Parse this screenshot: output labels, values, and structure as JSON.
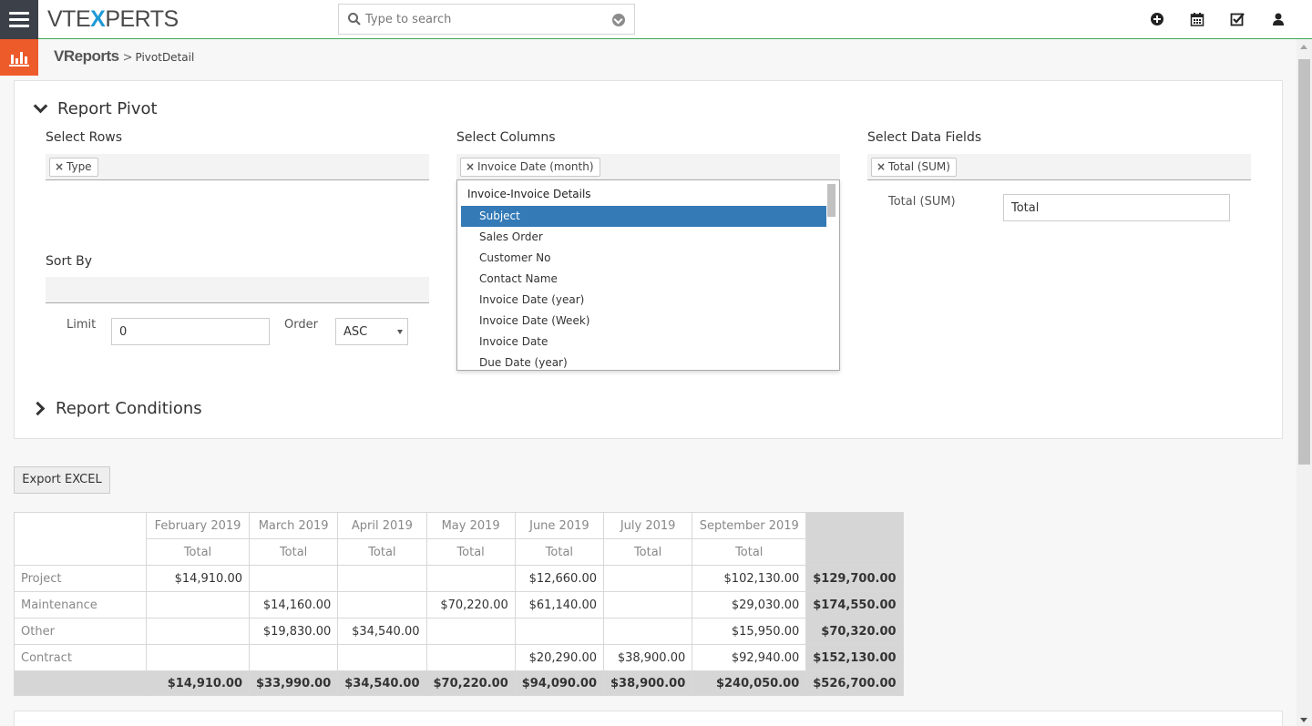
{
  "app": {
    "logo_part1": "VTE",
    "logo_x": "X",
    "logo_part2": "PERTS",
    "search_placeholder": "Type to search"
  },
  "icons": {
    "menu": "hamburger-menu-icon",
    "search": "search-icon",
    "search_dropdown": "chevron-down-icon",
    "add": "plus-circle-icon",
    "calendar": "calendar-icon",
    "tasks": "checkbox-icon",
    "user": "user-icon",
    "module": "bar-chart-icon"
  },
  "colors": {
    "accent_green": "#3aaa57",
    "module_orange": "#ee5b2b",
    "selected_blue": "#337ab7",
    "nav_dark": "#3c4049"
  },
  "breadcrumb": {
    "module": "VReports",
    "separator": ">",
    "page": "PivotDetail"
  },
  "report_pivot": {
    "title": "Report Pivot",
    "select_rows": {
      "label": "Select Rows",
      "tags": [
        "Type"
      ]
    },
    "select_columns": {
      "label": "Select Columns",
      "tags": [
        "Invoice Date (month)"
      ]
    },
    "select_data_fields": {
      "label": "Select Data Fields",
      "tags": [
        "Total (SUM)"
      ]
    },
    "data_field_row": {
      "label": "Total (SUM)",
      "value": "Total"
    },
    "sort_by": {
      "label": "Sort By"
    },
    "limit": {
      "label": "Limit",
      "value": "0"
    },
    "order": {
      "label": "Order",
      "value": "ASC"
    }
  },
  "columns_dropdown": {
    "group": "Invoice-Invoice Details",
    "items": [
      "Subject",
      "Sales Order",
      "Customer No",
      "Contact Name",
      "Invoice Date (year)",
      "Invoice Date (Week)",
      "Invoice Date",
      "Due Date (year)"
    ],
    "selected": "Subject"
  },
  "report_conditions": {
    "title": "Report Conditions"
  },
  "export_button": "Export EXCEL",
  "pivot_table": {
    "months": [
      "February 2019",
      "March 2019",
      "April 2019",
      "May 2019",
      "June 2019",
      "July 2019",
      "September 2019"
    ],
    "sub_header": "Total",
    "rows": [
      {
        "label": "Project",
        "cells": [
          "$14,910.00",
          "",
          "",
          "",
          "$12,660.00",
          "",
          "$102,130.00"
        ],
        "total": "$129,700.00"
      },
      {
        "label": "Maintenance",
        "cells": [
          "",
          "$14,160.00",
          "",
          "$70,220.00",
          "$61,140.00",
          "",
          "$29,030.00"
        ],
        "total": "$174,550.00"
      },
      {
        "label": "Other",
        "cells": [
          "",
          "$19,830.00",
          "$34,540.00",
          "",
          "",
          "",
          "$15,950.00"
        ],
        "total": "$70,320.00"
      },
      {
        "label": "Contract",
        "cells": [
          "",
          "",
          "",
          "",
          "$20,290.00",
          "$38,900.00",
          "$92,940.00"
        ],
        "total": "$152,130.00"
      }
    ],
    "totals": [
      "$14,910.00",
      "$33,990.00",
      "$34,540.00",
      "$70,220.00",
      "$94,090.00",
      "$38,900.00",
      "$240,050.00"
    ],
    "grand_total": "$526,700.00"
  }
}
